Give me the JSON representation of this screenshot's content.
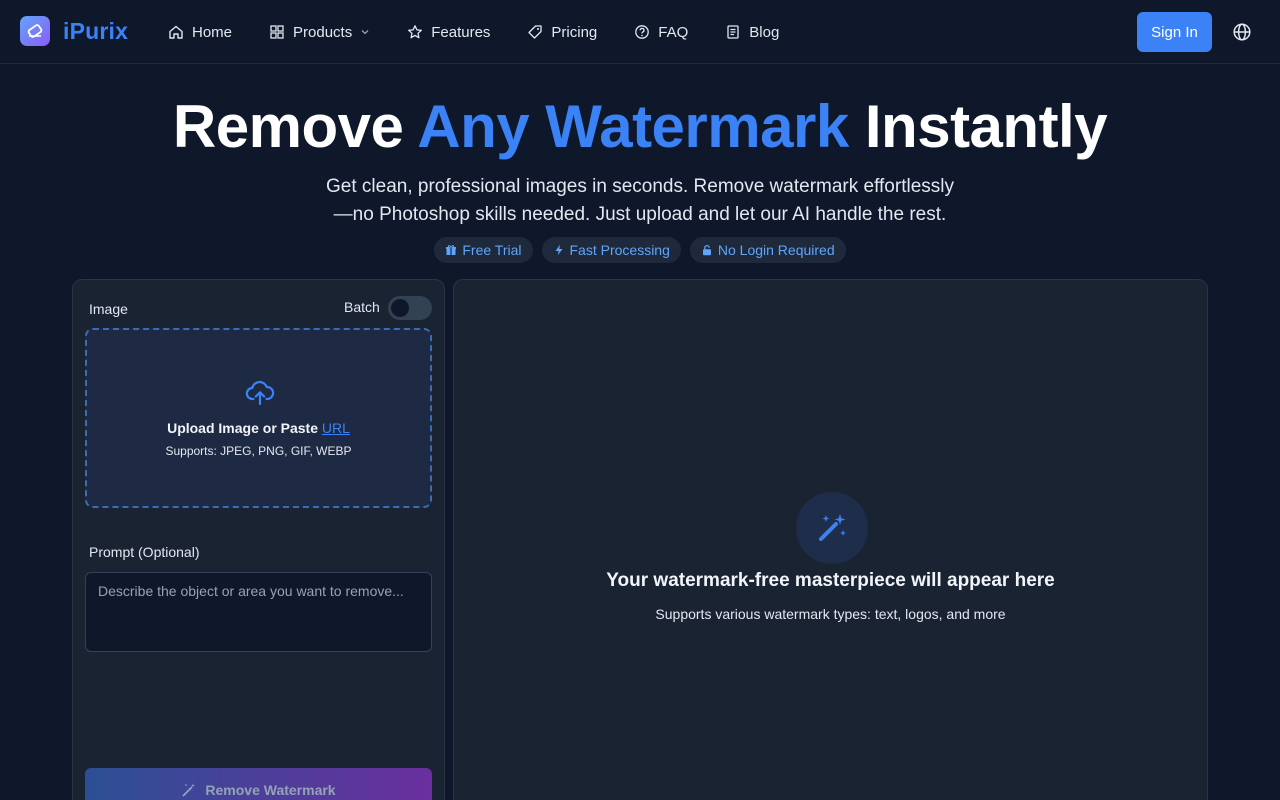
{
  "brand": {
    "name": "iPurix",
    "accent": "#3b82f6"
  },
  "nav": {
    "items": [
      {
        "label": "Home",
        "icon": "home-icon"
      },
      {
        "label": "Products",
        "icon": "grid-icon"
      },
      {
        "label": "Features",
        "icon": "star-icon"
      },
      {
        "label": "Pricing",
        "icon": "tag-icon"
      },
      {
        "label": "FAQ",
        "icon": "question-circle-icon"
      },
      {
        "label": "Blog",
        "icon": "document-icon"
      }
    ],
    "signin_label": "Sign In"
  },
  "hero": {
    "title_pre": "Remove ",
    "title_accent": "Any Watermark",
    "title_post": " Instantly",
    "subtitle_line1": "Get clean, professional images in seconds. Remove watermark effortlessly",
    "subtitle_line2": "—no Photoshop skills needed. Just upload and let our AI handle the rest.",
    "badges": [
      {
        "label": "Free Trial",
        "icon": "gift-icon"
      },
      {
        "label": "Fast Processing",
        "icon": "bolt-icon"
      },
      {
        "label": "No Login Required",
        "icon": "lock-icon"
      }
    ]
  },
  "editor": {
    "image_label": "Image",
    "batch_label": "Batch",
    "batch_enabled": false,
    "upload_title": "Upload Image or Paste ",
    "upload_link": "URL",
    "upload_formats": "Supports: JPEG, PNG, GIF, WEBP",
    "prompt_label": "Prompt (Optional)",
    "prompt_value": "",
    "prompt_placeholder": "Describe the object or area you want to remove...",
    "remove_button": "Remove Watermark"
  },
  "result": {
    "title": "Your watermark-free masterpiece will appear here",
    "subtitle": "Supports various watermark types: text, logos, and more"
  }
}
